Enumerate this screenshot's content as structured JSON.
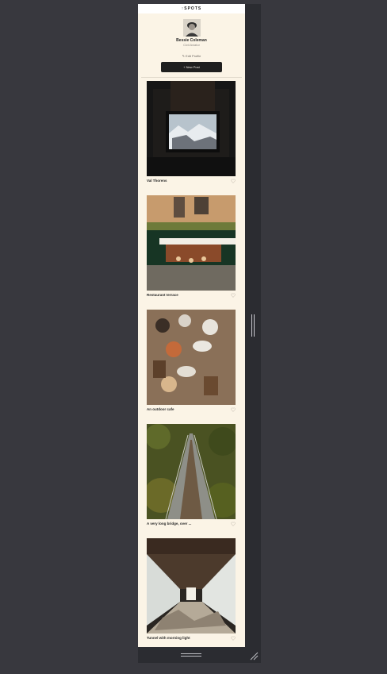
{
  "header": {
    "title": "↑SPOTS"
  },
  "profile": {
    "name": "Bessie Coleman",
    "subtitle": "Civil Aviator",
    "edit_label": "✎ Edit Profile",
    "new_post_label": "+ New Post"
  },
  "cards": [
    {
      "title": "Val Thorens",
      "liked": false
    },
    {
      "title": "Restaurant terrace",
      "liked": false
    },
    {
      "title": "An outdoor cafe",
      "liked": false
    },
    {
      "title": "A very long bridge, over ...",
      "liked": false
    },
    {
      "title": "Tunnel with morning light",
      "liked": false
    }
  ],
  "colors": {
    "page_background": "#38383e",
    "app_background": "#fbf4e6",
    "button_dark": "#1f1f1f"
  }
}
